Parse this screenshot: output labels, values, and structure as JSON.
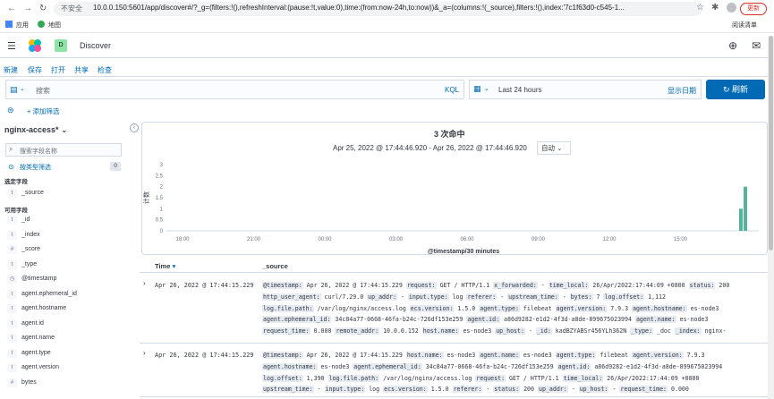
{
  "browser": {
    "nav_back": "←",
    "nav_forward": "→",
    "reload": "↻",
    "security": "不安全",
    "url": "10.0.0.150:5601/app/discover#/?_g=(filters:!(),refreshInterval:(pause:!t,value:0),time:(from:now-24h,to:now))&_a=(columns:!(_source),filters:!(),index:'7c1f63d0-c545-1...",
    "update_label": "更新",
    "bookmarks": [
      "应用",
      "地图"
    ],
    "reading_list": "阅读清单"
  },
  "kibana": {
    "space_letter": "D",
    "app_title": "Discover"
  },
  "top_nav": [
    "新建",
    "保存",
    "打开",
    "共享",
    "检查"
  ],
  "query": {
    "placeholder": "搜索",
    "language": "KQL"
  },
  "date": {
    "range": "Last 24 hours",
    "show_dates": "显示日期",
    "refresh_label": "刷新"
  },
  "filters": {
    "add_filter": "+ 添加筛选"
  },
  "sidebar": {
    "index_pattern": "nginx-access*",
    "search_placeholder": "搜索字段名称",
    "filter_by_type": "按类型筛选",
    "filter_count": "0",
    "selected_heading": "选定字段",
    "selected_fields": [
      {
        "icon": "t",
        "name": "_source"
      }
    ],
    "available_heading": "可用字段",
    "available_fields": [
      {
        "icon": "t",
        "name": "_id"
      },
      {
        "icon": "t",
        "name": "_index"
      },
      {
        "icon": "#",
        "name": "_score"
      },
      {
        "icon": "t",
        "name": "_type"
      },
      {
        "icon": "◷",
        "name": "@timestamp"
      },
      {
        "icon": "t",
        "name": "agent.ephemeral_id"
      },
      {
        "icon": "t",
        "name": "agent.hostname"
      },
      {
        "icon": "t",
        "name": "agent.id"
      },
      {
        "icon": "t",
        "name": "agent.name"
      },
      {
        "icon": "t",
        "name": "agent.type"
      },
      {
        "icon": "t",
        "name": "agent.version"
      },
      {
        "icon": "#",
        "name": "bytes"
      }
    ]
  },
  "hits": {
    "count": "3",
    "label": "次命中",
    "time_range": "Apr 25, 2022 @ 17:44:46.920 - Apr 26, 2022 @ 17:44:46.920",
    "interval": "自动"
  },
  "chart_data": {
    "type": "bar",
    "ylabel": "计数",
    "xlabel": "@timestamp/30 minutes",
    "y_ticks": [
      "3",
      "2.5",
      "2",
      "1.5",
      "1",
      "0.5",
      "0"
    ],
    "x_ticks": [
      "18:00",
      "21:00",
      "00:00",
      "03:00",
      "06:00",
      "09:00",
      "12:00",
      "15:00"
    ],
    "ylim": [
      0,
      3
    ],
    "series": [
      {
        "values": [
          1,
          2
        ]
      }
    ],
    "bar_color": "#54b399"
  },
  "table": {
    "col_time": "Time",
    "col_source": "_source",
    "rows": [
      {
        "time": "Apr 26, 2022 @ 17:44:15.229",
        "lines": [
          [
            [
              "@timestamp:",
              "Apr 26, 2022 @ 17:44:15.229"
            ],
            [
              "request:",
              "GET / HTTP/1.1"
            ],
            [
              "x_forwarded:",
              "-"
            ],
            [
              "time_local:",
              "26/Apr/2022:17:44:09 +0800"
            ],
            [
              "status:",
              "200"
            ]
          ],
          [
            [
              "http_user_agent:",
              "curl/7.29.0"
            ],
            [
              "up_addr:",
              "-"
            ],
            [
              "input.type:",
              "log"
            ],
            [
              "referer:",
              "-"
            ],
            [
              "upstream_time:",
              "-"
            ],
            [
              "bytes:",
              "7"
            ],
            [
              "log.offset:",
              "1,112"
            ]
          ],
          [
            [
              "log.file.path:",
              "/var/log/nginx/access.log"
            ],
            [
              "ecs.version:",
              "1.5.0"
            ],
            [
              "agent.type:",
              "filebeat"
            ],
            [
              "agent.version:",
              "7.9.3"
            ],
            [
              "agent.hostname:",
              "es-node3"
            ]
          ],
          [
            [
              "agent.ephemeral_id:",
              "34c84a77-0668-46fa-b24c-726df153e259"
            ],
            [
              "agent.id:",
              "a86d9282-e1d2-4f3d-a8de-899675023994"
            ],
            [
              "agent.name:",
              "es-node3"
            ]
          ],
          [
            [
              "request_time:",
              "0.000"
            ],
            [
              "remote_addr:",
              "10.0.0.152"
            ],
            [
              "host.name:",
              "es-node3"
            ],
            [
              "up_host:",
              "-"
            ],
            [
              "_id:",
              "kadBZYABSr456YLh362N"
            ],
            [
              "_type:",
              "_doc"
            ],
            [
              "_index:",
              "nginx-"
            ]
          ]
        ]
      },
      {
        "time": "Apr 26, 2022 @ 17:44:15.229",
        "lines": [
          [
            [
              "@timestamp:",
              "Apr 26, 2022 @ 17:44:15.229"
            ],
            [
              "host.name:",
              "es-node3"
            ],
            [
              "agent.name:",
              "es-node3"
            ],
            [
              "agent.type:",
              "filebeat"
            ],
            [
              "agent.version:",
              "7.9.3"
            ]
          ],
          [
            [
              "agent.hostname:",
              "es-node3"
            ],
            [
              "agent.ephemeral_id:",
              "34c84a77-0668-46fa-b24c-726df153e259"
            ],
            [
              "agent.id:",
              "a86d9282-e1d2-4f3d-a8de-899675023994"
            ]
          ],
          [
            [
              "log.offset:",
              "1,390"
            ],
            [
              "log.file.path:",
              "/var/log/nginx/access.log"
            ],
            [
              "request:",
              "GET / HTTP/1.1"
            ],
            [
              "time_local:",
              "26/Apr/2022:17:44:09 +0800"
            ]
          ],
          [
            [
              "upstream_time:",
              "-"
            ],
            [
              "input.type:",
              "log"
            ],
            [
              "ecs.version:",
              "1.5.0"
            ],
            [
              "referer:",
              "-"
            ],
            [
              "status:",
              "200"
            ],
            [
              "up_addr:",
              "-"
            ],
            [
              "up_host:",
              "-"
            ],
            [
              "request_time:",
              "0.000"
            ]
          ]
        ]
      }
    ]
  }
}
